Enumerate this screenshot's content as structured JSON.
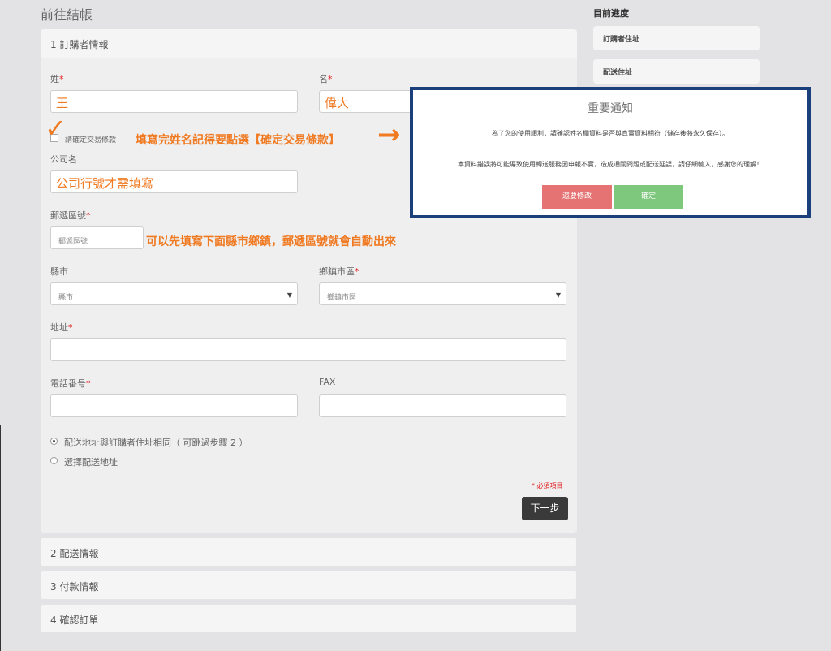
{
  "page_title": "前往結帳",
  "step1": {
    "header": "1 訂購者情報"
  },
  "form": {
    "last_name_label": "姓",
    "required_mark": "*",
    "last_name_value": "王",
    "first_name_label": "名",
    "first_name_value": "偉大",
    "terms_label": "請確定交易條款",
    "company_label": "公司名",
    "company_value": "公司行號才需填寫",
    "zip_label": "郵遞區號",
    "zip_placeholder": "郵遞區號",
    "county_label": "縣市",
    "county_value": "縣市",
    "district_label": "鄉鎮市區",
    "district_value": "鄉鎮市區",
    "address_label": "地址",
    "phone_label": "電話番号",
    "fax_label": "FAX",
    "radio_same": "配送地址與訂購者住址相同（ 可跳過步驟 2 ）",
    "radio_choose": "選擇配送地址",
    "required_note": "* 必須項目",
    "next_button": "下一步"
  },
  "annotations": {
    "check_mark": "✓",
    "terms_note": "填寫完姓名記得要點選【確定交易條款】",
    "arrow": "→",
    "zip_note": "可以先填寫下面縣市鄉鎮，郵遞區號就會自動出來"
  },
  "sections": [
    "2 配送情報",
    "3 付款情報",
    "4 確認訂單"
  ],
  "sidebar": {
    "title": "目前進度",
    "items": [
      "訂購者住址",
      "配送住址"
    ]
  },
  "modal": {
    "title": "重要通知",
    "line1": "為了您的使用順利，請確認姓名欄資料是否與真實資料相符（儲存後將永久保存）。",
    "line2": "本資料錯誤將可能導致使用轉送服務因申報不實，造成通關問題或配送延誤，請仔細輸入，感謝您的理解！",
    "cancel_button": "還要修改",
    "confirm_button": "確定"
  },
  "colors": {
    "annotation": "#f07a22",
    "modal_border": "#1b3f7a",
    "cancel": "#e57373",
    "confirm": "#7ec87e"
  }
}
